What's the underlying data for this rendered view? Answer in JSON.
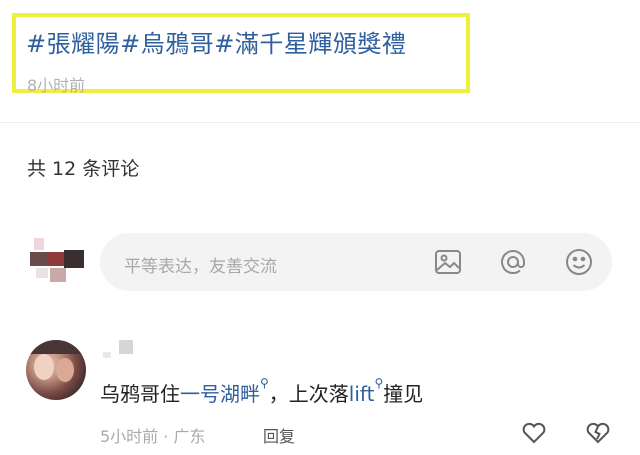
{
  "post": {
    "tags": "#張耀陽#烏鴉哥#滿千星輝頒獎禮",
    "time": "8小时前"
  },
  "comments_header": {
    "count_text": "共 12 条评论"
  },
  "comment_input": {
    "placeholder": "平等表达，友善交流",
    "icons": [
      "image-icon",
      "at-icon",
      "emoji-icon"
    ]
  },
  "comment": {
    "text_before": "乌鸦哥住",
    "link1": "一号湖畔",
    "text_middle": "，上次落",
    "link2": "lift",
    "text_after": "撞见",
    "meta": "5小时前 · 广东",
    "reply_label": "回复"
  },
  "colors": {
    "link": "#2e5f9e",
    "highlight": "#f2ee3c",
    "muted": "#b3b3b3"
  }
}
